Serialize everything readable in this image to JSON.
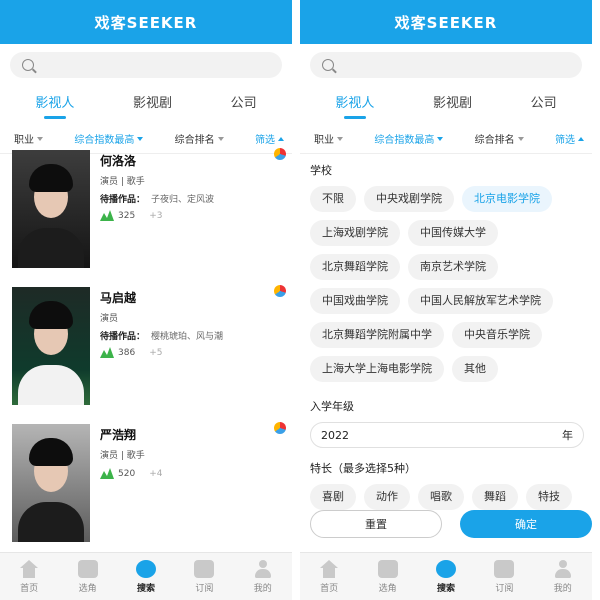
{
  "app_title": "戏客SEEKER",
  "tabs": [
    "影视人",
    "影视剧",
    "公司"
  ],
  "filters": {
    "occupation": "职业",
    "sort_index": "综合指数最高",
    "sort_rank": "综合排名",
    "screen": "筛选"
  },
  "people": [
    {
      "name": "何洛洛",
      "role": "演员 | 歌手",
      "works_label": "待播作品：",
      "works": "子夜归、定风波",
      "score": "325",
      "delta": "+3"
    },
    {
      "name": "马启越",
      "role": "演员",
      "works_label": "待播作品：",
      "works": "樱桃琥珀、风与潮",
      "score": "386",
      "delta": "+5"
    },
    {
      "name": "严浩翔",
      "role": "演员 | 歌手",
      "works_label": "",
      "works": "",
      "score": "520",
      "delta": "+4"
    }
  ],
  "filter_panel": {
    "school_title": "学校",
    "schools": [
      "不限",
      "中央戏剧学院",
      "北京电影学院",
      "上海戏剧学院",
      "中国传媒大学",
      "北京舞蹈学院",
      "南京艺术学院",
      "中国戏曲学院",
      "中国人民解放军艺术学院",
      "北京舞蹈学院附属中学",
      "中央音乐学院",
      "上海大学上海电影学院",
      "其他"
    ],
    "selected_school": "北京电影学院",
    "year_title": "入学年级",
    "year_value": "2022",
    "year_unit": "年",
    "skills_title": "特长（最多选择5种）",
    "skills": [
      "喜剧",
      "动作",
      "唱歌",
      "舞蹈",
      "特技"
    ],
    "reset_label": "重置",
    "confirm_label": "确定"
  },
  "bottom_nav": [
    "首页",
    "选角",
    "搜索",
    "订阅",
    "我的"
  ],
  "accent_color": "#1aa3e8"
}
